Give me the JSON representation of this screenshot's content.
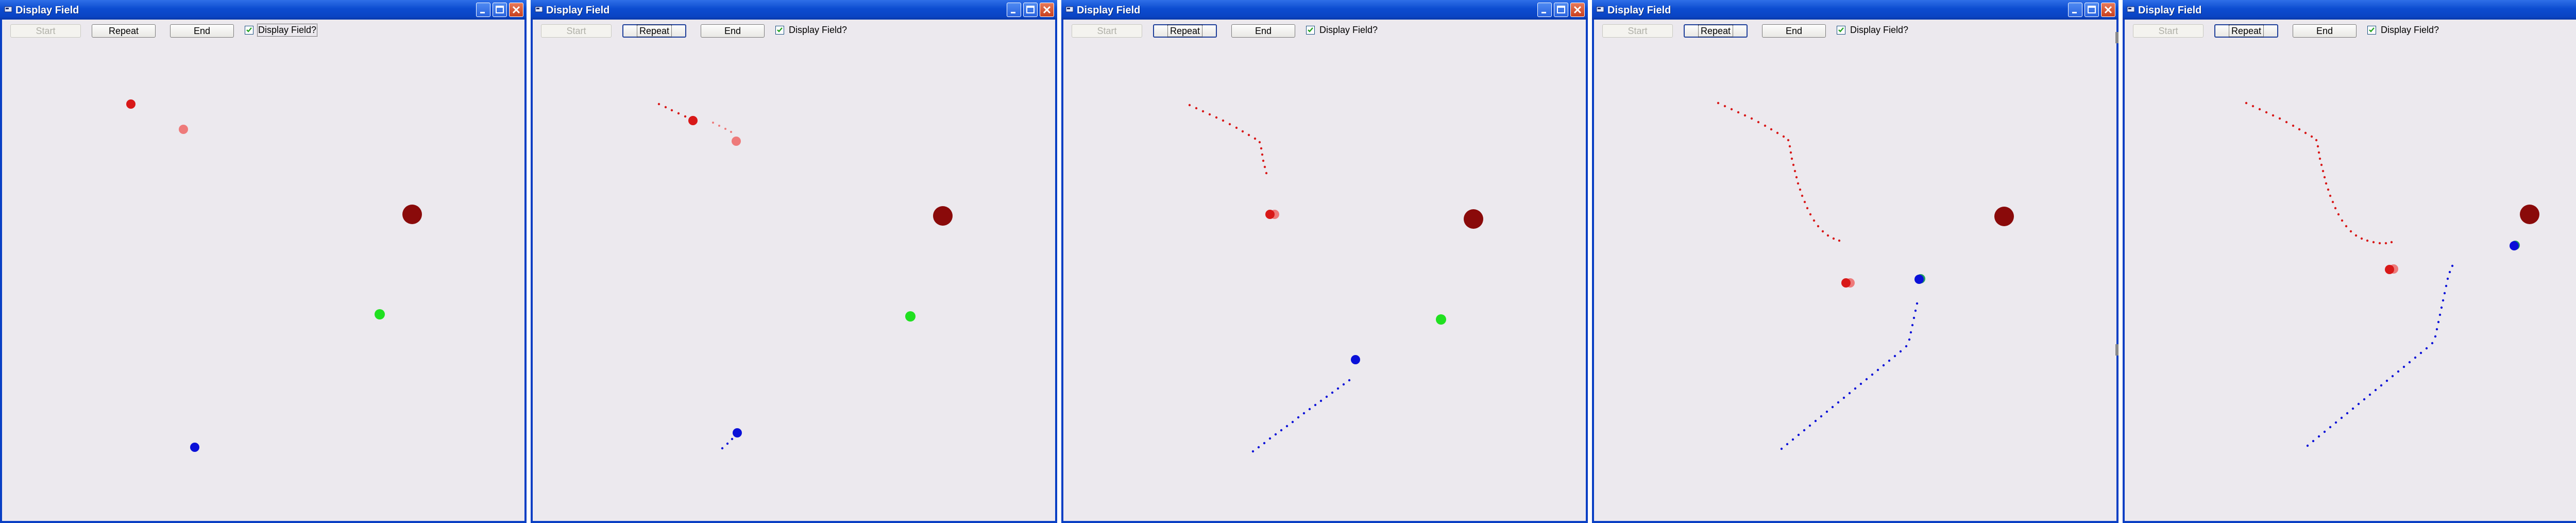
{
  "window_title": "Display Field",
  "toolbar": {
    "start_label": "Start",
    "repeat_label": "Repeat",
    "end_label": "End",
    "checkbox_label": "Display Field?",
    "checkbox_checked": true
  },
  "colors": {
    "agent_red": "#e01010",
    "ghost_red": "#f07878",
    "agent_blue": "#0a10d8",
    "goal_green": "#20e020",
    "obstacle_darkred": "#8a0a0a",
    "title_blue": "#0a44c4",
    "client_bg": "#ece9ee"
  },
  "frames": [
    {
      "index": 1,
      "start_disabled": true,
      "focused": "checkbox",
      "has_goal": true,
      "agent_collision": false
    },
    {
      "index": 2,
      "start_disabled": true,
      "focused": "repeat",
      "has_goal": true,
      "agent_collision": false
    },
    {
      "index": 3,
      "start_disabled": true,
      "focused": "repeat",
      "has_goal": true,
      "agent_collision": false
    },
    {
      "index": 4,
      "start_disabled": true,
      "focused": "repeat",
      "has_goal": false,
      "agent_collision": true
    },
    {
      "index": 5,
      "start_disabled": true,
      "focused": "repeat",
      "has_goal": false,
      "agent_collision": true
    }
  ]
}
